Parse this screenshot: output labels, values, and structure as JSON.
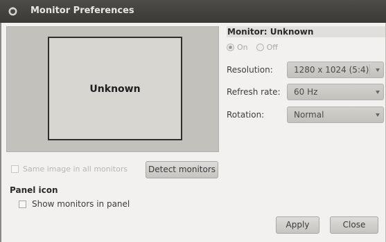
{
  "window": {
    "title": "Monitor Preferences",
    "icon": "monitor-preferences-icon"
  },
  "preview": {
    "monitor_label": "Unknown"
  },
  "monitor": {
    "header": "Monitor: Unknown",
    "on_label": "On",
    "off_label": "Off",
    "on_selected": true,
    "resolution_label": "Resolution:",
    "resolution_value": "1280 x 1024 (5:4)",
    "refresh_label": "Refresh rate:",
    "refresh_value": "60 Hz",
    "rotation_label": "Rotation:",
    "rotation_value": "Normal"
  },
  "options": {
    "same_image_label": "Same image in all monitors",
    "same_image_checked": false,
    "detect_label": "Detect monitors"
  },
  "panel": {
    "title": "Panel icon",
    "show_label": "Show monitors in panel",
    "show_checked": false
  },
  "actions": {
    "apply_label": "Apply",
    "close_label": "Close"
  },
  "colors": {
    "titlebar": "#3e3d39",
    "window_bg": "#f2f1f0",
    "preview_bg": "#c3c1bc"
  }
}
